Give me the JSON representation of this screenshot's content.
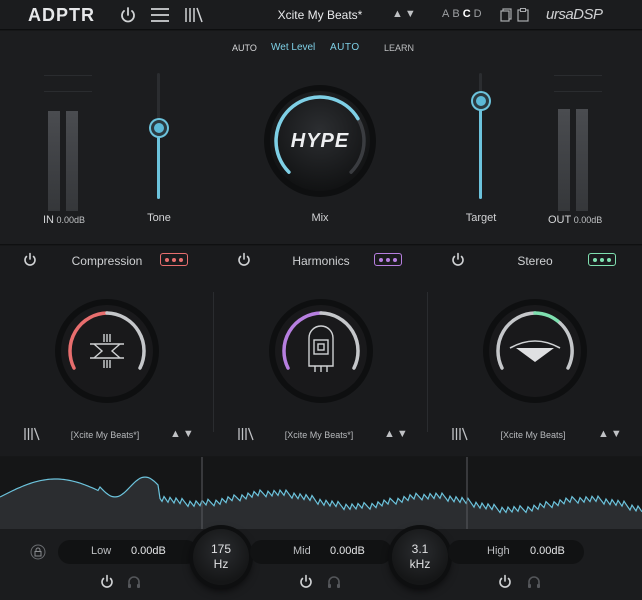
{
  "topbar": {
    "logo": "ADPTR",
    "preset_name": "Xcite My Beats*",
    "nav_arrows": "▲▼",
    "ab_slots": [
      "A",
      "B",
      "C",
      "D"
    ],
    "active_slot": "C",
    "brand": "ursaDSP"
  },
  "main": {
    "auto_left": "AUTO",
    "wet_level": "Wet Level",
    "auto_right": "AUTO",
    "learn": "LEARN",
    "in_label": "IN",
    "in_value": "0.00dB",
    "out_label": "OUT",
    "out_value": "0.00dB",
    "tone_label": "Tone",
    "target_label": "Target",
    "mix_label": "Mix",
    "hype_text": "HYPE",
    "tone_level": 0.56,
    "target_level": 0.78,
    "mix_level": 0.72
  },
  "modules": [
    {
      "title": "Compression",
      "preset": "[Xcite My Beats*]",
      "arrows": "▲▼",
      "accent": "#e86e6e"
    },
    {
      "title": "Harmonics",
      "preset": "[Xcite My Beats*]",
      "arrows": "▲▼",
      "accent": "#b77fe0"
    },
    {
      "title": "Stereo",
      "preset": "[Xcite My Beats]",
      "arrows": "▲▼",
      "accent": "#7fe0b0"
    }
  ],
  "bands": {
    "low_label": "Low",
    "low_value": "0.00dB",
    "mid_label": "Mid",
    "mid_value": "0.00dB",
    "high_label": "High",
    "high_value": "0.00dB",
    "xover1_value": "175",
    "xover1_unit": "Hz",
    "xover2_value": "3.1",
    "xover2_unit": "kHz"
  },
  "colors": {
    "accent": "#6cc3dc",
    "compression": "#e86e6e",
    "harmonics": "#b77fe0",
    "stereo": "#7fe0b0"
  }
}
